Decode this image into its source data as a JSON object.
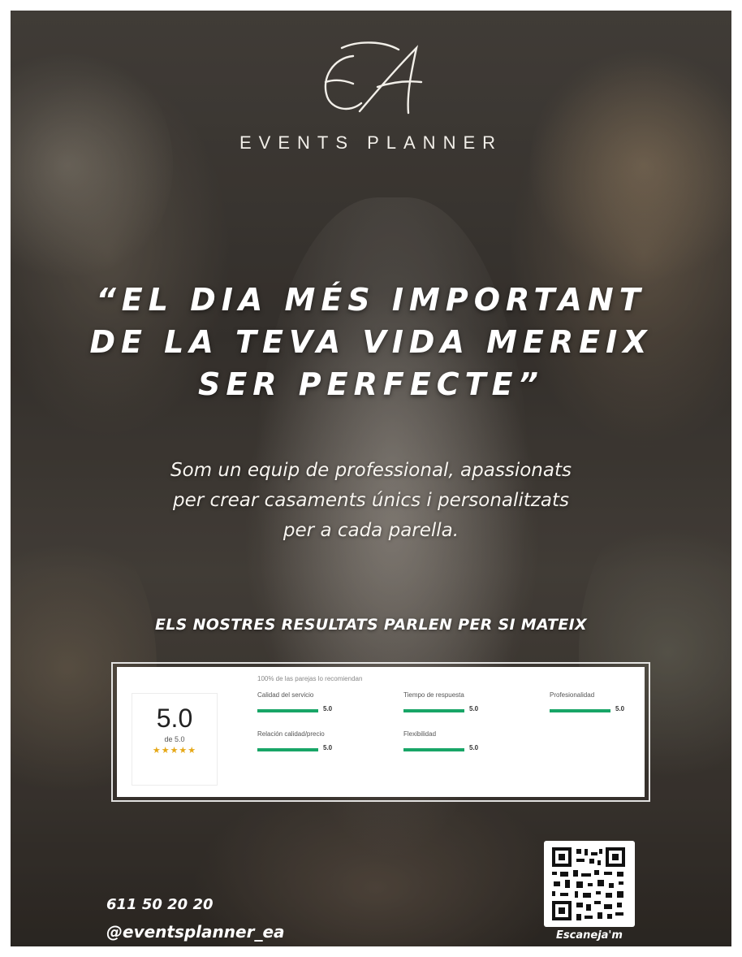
{
  "brand": {
    "logo_text": "EA",
    "subtitle": "EVENTS PLANNER"
  },
  "headline": {
    "line1": "“EL DIA MÉS IMPORTANT",
    "line2": "DE LA TEVA VIDA MEREIX",
    "line3": "SER PERFECTE”"
  },
  "description": {
    "line1": "Som un equip de professional, apassionats",
    "line2": "per crear casaments únics i personalitzats",
    "line3": "per a cada parella."
  },
  "results_heading": "ELS NOSTRES RESULTATS PARLEN PER SI MATEIX",
  "rating": {
    "score": "5.0",
    "out_of": "de 5.0",
    "stars": "★★★★★",
    "recommend_text": "100% de las parejas lo recomiendan",
    "star_color": "#e6a817",
    "bar_color": "#18a567",
    "metrics": [
      {
        "label": "Calidad del servicio",
        "value": "5.0",
        "fraction": 1.0
      },
      {
        "label": "Tiempo de respuesta",
        "value": "5.0",
        "fraction": 1.0
      },
      {
        "label": "Profesionalidad",
        "value": "5.0",
        "fraction": 1.0
      },
      {
        "label": "Relación calidad/precio",
        "value": "5.0",
        "fraction": 1.0
      },
      {
        "label": "Flexibilidad",
        "value": "5.0",
        "fraction": 1.0
      }
    ]
  },
  "contact": {
    "phone": "611 50 20 20",
    "handle": "@eventsplanner_ea",
    "qr_caption": "Escaneja'm"
  }
}
